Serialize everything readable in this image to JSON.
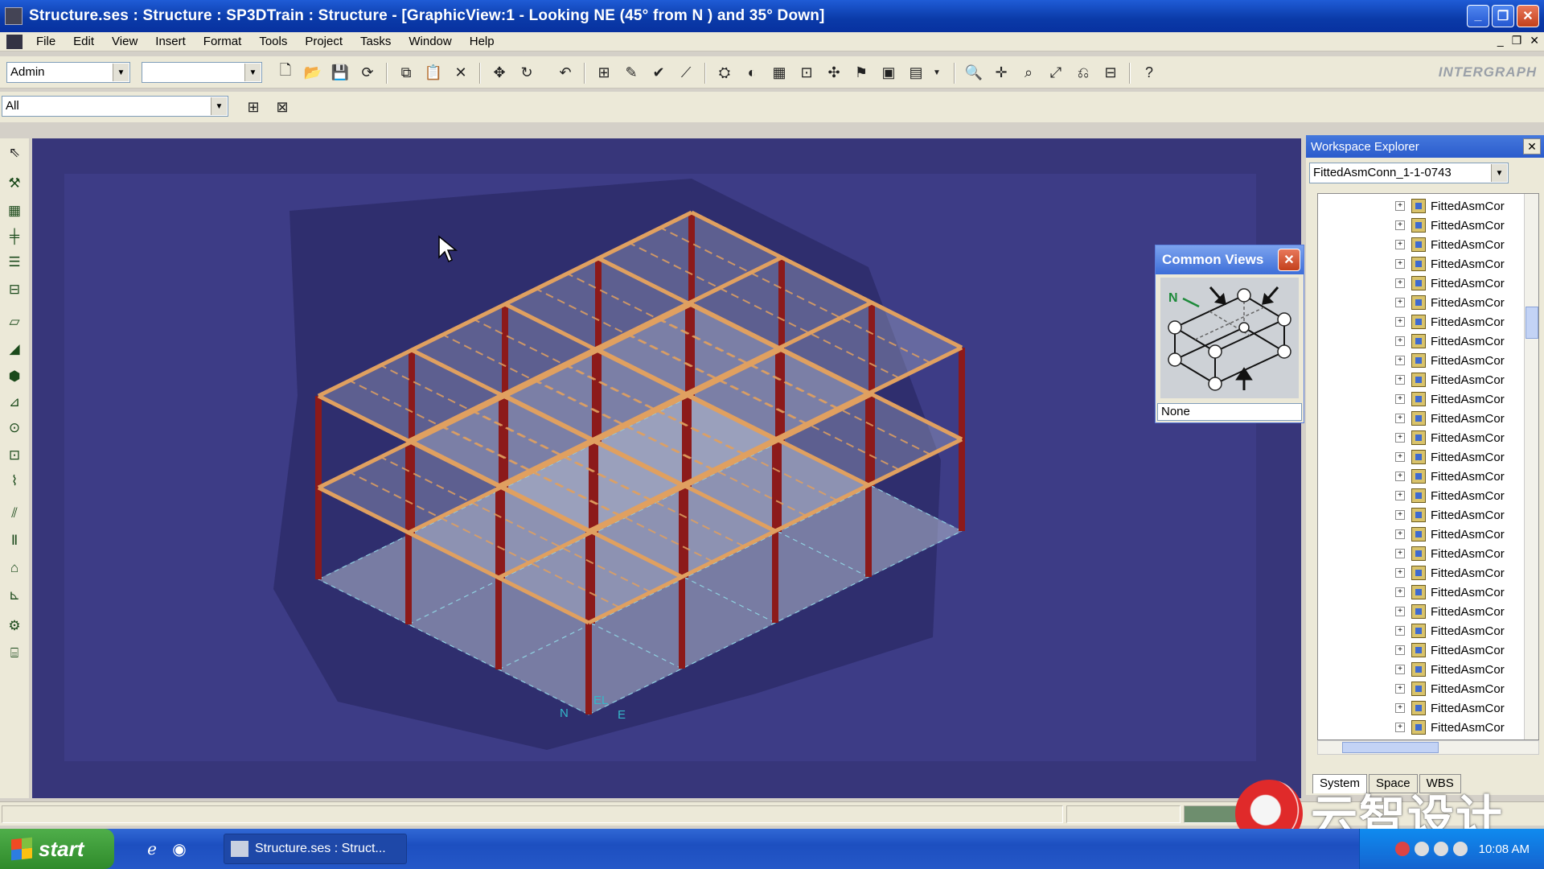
{
  "window": {
    "title": "Structure.ses : Structure : SP3DTrain : Structure - [GraphicView:1 - Looking NE (45° from N ) and 35° Down]"
  },
  "menu": [
    "File",
    "Edit",
    "View",
    "Insert",
    "Format",
    "Tools",
    "Project",
    "Tasks",
    "Window",
    "Help"
  ],
  "toolbar": {
    "permission_group": "Admin",
    "second_combo": "",
    "filter": "All",
    "logo": "INTERGRAPH"
  },
  "common_views": {
    "title": "Common Views",
    "north_label": "N",
    "value": "None"
  },
  "workspace_explorer": {
    "title": "Workspace Explorer",
    "selected": "FittedAsmConn_1-1-0743",
    "item_label": "FittedAsmCor",
    "item_count": 28,
    "tabs": [
      "System",
      "Space",
      "WBS"
    ],
    "active_tab": "System"
  },
  "graphic_view": {
    "compass_labels": [
      "N",
      "EL",
      "E"
    ]
  },
  "watermark": {
    "text": "云智设计"
  },
  "taskbar": {
    "start_label": "start",
    "task_item": "Structure.ses : Struct...",
    "clock": "10:08 AM"
  },
  "colors": {
    "viewport_bg": "#37367a",
    "beam": "#e0a060",
    "column": "#8c1a1a",
    "slab": "#b4bcd0"
  }
}
